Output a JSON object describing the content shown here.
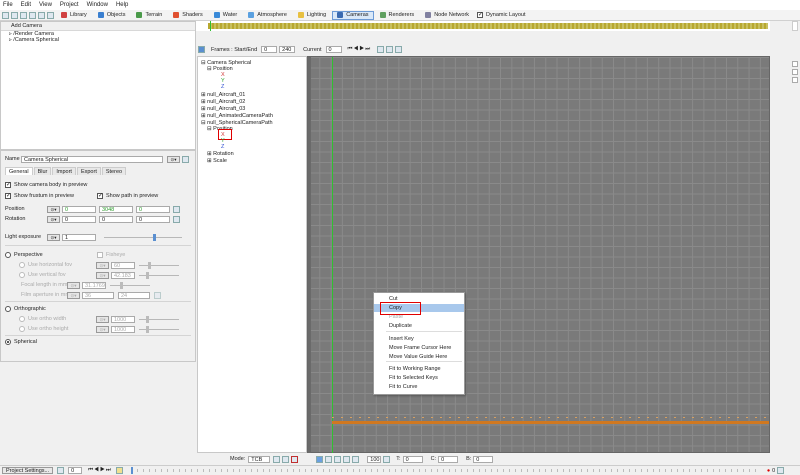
{
  "menu": [
    "File",
    "Edit",
    "View",
    "Project",
    "Window",
    "Help"
  ],
  "toolbar_tabs": [
    {
      "label": "Library",
      "icon": "library-icon",
      "color": "#d04040",
      "active": false
    },
    {
      "label": "Objects",
      "icon": "objects-icon",
      "color": "#3a7fd0",
      "active": false
    },
    {
      "label": "Terrain",
      "icon": "terrain-icon",
      "color": "#4a9a4a",
      "active": false
    },
    {
      "label": "Shaders",
      "icon": "shaders-icon",
      "color": "#e05030",
      "active": false
    },
    {
      "label": "Water",
      "icon": "water-icon",
      "color": "#3a8ad8",
      "active": false
    },
    {
      "label": "Atmosphere",
      "icon": "atmosphere-icon",
      "color": "#5aa0e0",
      "active": false
    },
    {
      "label": "Lighting",
      "icon": "lighting-icon",
      "color": "#e8c040",
      "active": false
    },
    {
      "label": "Cameras",
      "icon": "cameras-icon",
      "color": "#3a6ab0",
      "active": true
    },
    {
      "label": "Renderers",
      "icon": "renderers-icon",
      "color": "#60a060",
      "active": false
    },
    {
      "label": "Node Network",
      "icon": "node-network-icon",
      "color": "#8080a0",
      "active": false
    }
  ],
  "dynamic_layout_label": "Dynamic Layout",
  "camera_list": {
    "add_label": "Add Camera",
    "items": [
      "/Render Camera",
      "/Camera Spherical"
    ]
  },
  "props": {
    "name_label": "Name",
    "name_value": "Camera Spherical",
    "tabs": [
      "General",
      "Blur",
      "Import",
      "Export",
      "Stereo"
    ],
    "show_body": "Show camera body in preview",
    "show_frustum": "Show frustum in preview",
    "show_path": "Show path in preview",
    "position_label": "Position",
    "position": [
      "0",
      "3048",
      "0"
    ],
    "rotation_label": "Rotation",
    "rotation": [
      "0",
      "0",
      "0"
    ],
    "light_exposure_label": "Light exposure",
    "light_exposure": "1",
    "light_exposure_level": 0.65,
    "perspective": "Perspective",
    "fisheye": "Fisheye",
    "use_hfov": "Use horizontal fov",
    "hfov": "60",
    "use_vfov": "Use vertical fov",
    "vfov": "42.183",
    "focal_label": "Focal length in mm",
    "focal": "31.1769",
    "film_label": "Film aperture in mm",
    "film_w": "36",
    "film_h": "24",
    "orthographic": "Orthographic",
    "use_ortho_w": "Use ortho width",
    "ortho_w": "1000",
    "use_ortho_h": "Use ortho height",
    "ortho_h": "1000",
    "spherical": "Spherical"
  },
  "timeline": {
    "frames_label": "Frames : Start/End",
    "start": "0",
    "end": "240",
    "current_label": "Current",
    "current": "0"
  },
  "tree": [
    {
      "label": "Camera Spherical",
      "level": 0,
      "prefix": "⊟"
    },
    {
      "label": "Position",
      "level": 1,
      "prefix": "⊟"
    },
    {
      "label": "X",
      "level": 2,
      "prefix": "",
      "color": "#d03030"
    },
    {
      "label": "Y",
      "level": 2,
      "prefix": "",
      "color": "#30a030"
    },
    {
      "label": "Z",
      "level": 2,
      "prefix": "",
      "color": "#3050d0"
    },
    {
      "label": "null_Aircraft_01",
      "level": 0,
      "prefix": "⊞"
    },
    {
      "label": "null_Aircraft_02",
      "level": 0,
      "prefix": "⊞"
    },
    {
      "label": "null_Aircraft_03",
      "level": 0,
      "prefix": "⊞"
    },
    {
      "label": "null_AnimatedCameraPath",
      "level": 0,
      "prefix": "⊞"
    },
    {
      "label": "null_SphericalCameraPath",
      "level": 0,
      "prefix": "⊟"
    },
    {
      "label": "Position",
      "level": 1,
      "prefix": "⊟"
    },
    {
      "label": "X",
      "level": 2,
      "prefix": "",
      "color": "#d03030"
    },
    {
      "label": "Y",
      "level": 2,
      "prefix": "",
      "color": "#30a030"
    },
    {
      "label": "Z",
      "level": 2,
      "prefix": "",
      "color": "#3050d0"
    },
    {
      "label": "Rotation",
      "level": 1,
      "prefix": "⊞"
    },
    {
      "label": "Scale",
      "level": 1,
      "prefix": "⊞"
    }
  ],
  "context_menu": [
    "Cut",
    "Copy",
    "Paste",
    "Duplicate",
    "Insert Key",
    "Move Frame Cursor Here",
    "Move Value Guide Here",
    "Fit to Working Range",
    "Fit to Selected Keys",
    "Fit to Curve"
  ],
  "bottom": {
    "mode_label": "Mode:",
    "mode_value": "TCB",
    "zoom": "100",
    "t_label": "T:",
    "t_value": "0",
    "c_label": "C:",
    "c_value": "0",
    "b_label": "B:",
    "b_value": "0"
  },
  "status": {
    "project_settings": "Project Settings...",
    "frame": "0",
    "counter": "0"
  }
}
